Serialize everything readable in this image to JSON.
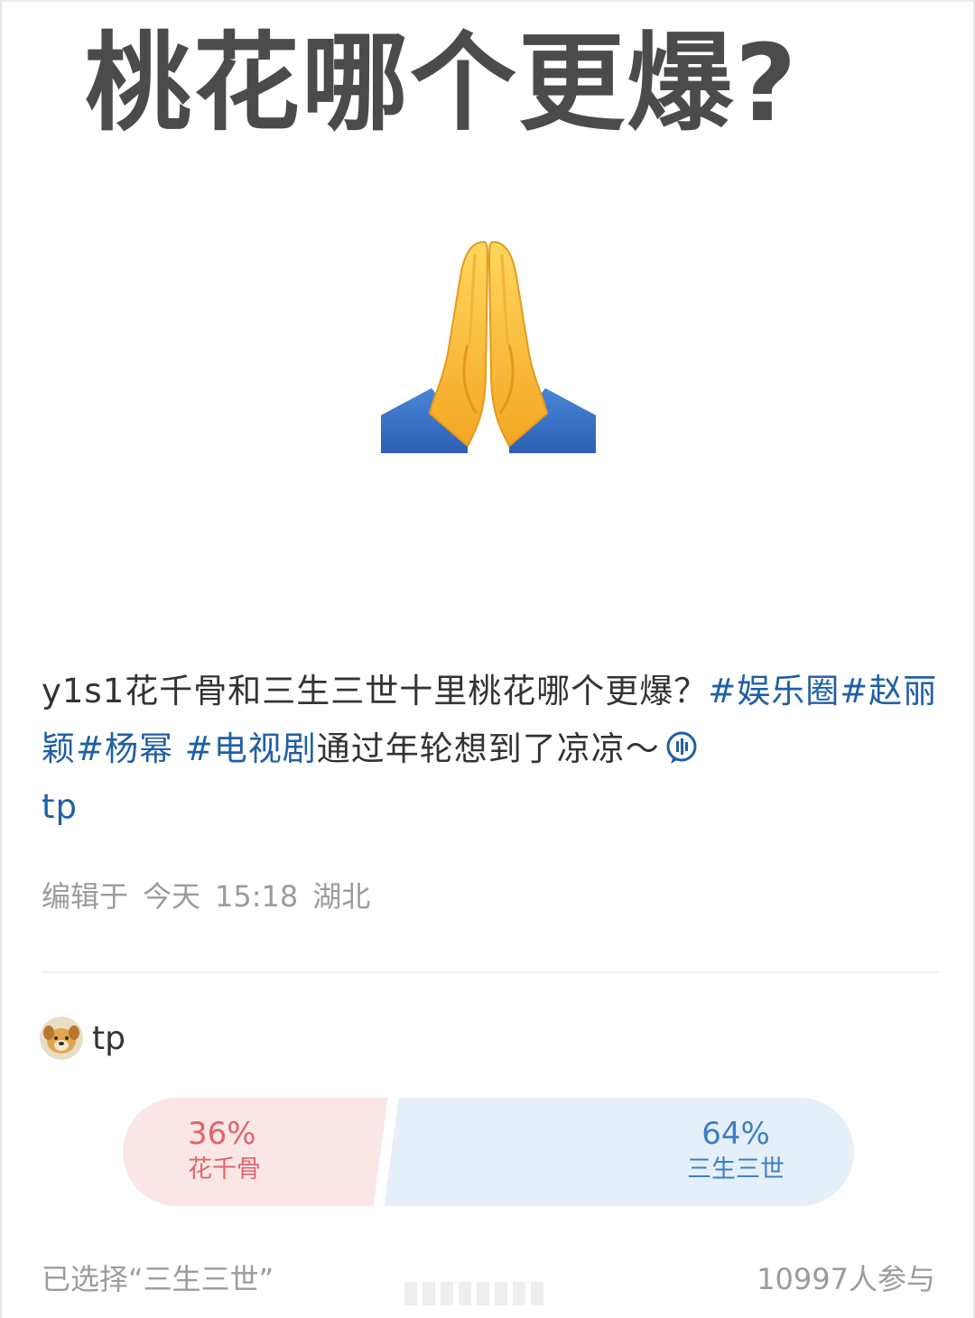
{
  "headline": "桃花哪个更爆?",
  "post": {
    "prefix": "y1s1花千骨和三生三世十里桃花哪个更爆？",
    "tag_ent": "#娱乐圈",
    "tag_zly": "#赵丽颖",
    "tag_ym": "#杨幂",
    "tag_tv": "#电视剧",
    "body_after": "通过年轮想到了凉凉～",
    "link_tp": "tp"
  },
  "meta": {
    "edited": "编辑于",
    "day": "今天",
    "time": "15:18",
    "location": "湖北"
  },
  "author": {
    "name": "tp"
  },
  "poll": {
    "left_pct": "36%",
    "left_label": "花千骨",
    "right_pct": "64%",
    "right_label": "三生三世",
    "left_share": 36,
    "right_share": 64,
    "left_color": "#fbe6e6",
    "right_color": "#e5effa"
  },
  "footer": {
    "selected": "已选择“三生三世”",
    "participants": "10997人参与"
  },
  "icons": {
    "emoji": "folded-hands-icon",
    "inline": "voice-bubble-icon",
    "avatar": "dog-avatar-icon"
  }
}
